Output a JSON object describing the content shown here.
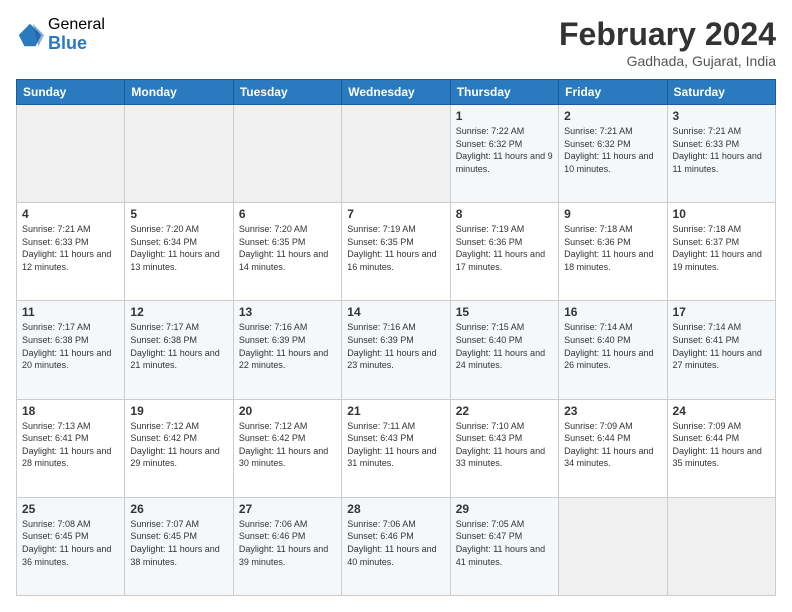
{
  "logo": {
    "general": "General",
    "blue": "Blue"
  },
  "header": {
    "title": "February 2024",
    "subtitle": "Gadhada, Gujarat, India"
  },
  "days_of_week": [
    "Sunday",
    "Monday",
    "Tuesday",
    "Wednesday",
    "Thursday",
    "Friday",
    "Saturday"
  ],
  "weeks": [
    [
      {
        "day": "",
        "info": ""
      },
      {
        "day": "",
        "info": ""
      },
      {
        "day": "",
        "info": ""
      },
      {
        "day": "",
        "info": ""
      },
      {
        "day": "1",
        "info": "Sunrise: 7:22 AM\nSunset: 6:32 PM\nDaylight: 11 hours and 9 minutes."
      },
      {
        "day": "2",
        "info": "Sunrise: 7:21 AM\nSunset: 6:32 PM\nDaylight: 11 hours and 10 minutes."
      },
      {
        "day": "3",
        "info": "Sunrise: 7:21 AM\nSunset: 6:33 PM\nDaylight: 11 hours and 11 minutes."
      }
    ],
    [
      {
        "day": "4",
        "info": "Sunrise: 7:21 AM\nSunset: 6:33 PM\nDaylight: 11 hours and 12 minutes."
      },
      {
        "day": "5",
        "info": "Sunrise: 7:20 AM\nSunset: 6:34 PM\nDaylight: 11 hours and 13 minutes."
      },
      {
        "day": "6",
        "info": "Sunrise: 7:20 AM\nSunset: 6:35 PM\nDaylight: 11 hours and 14 minutes."
      },
      {
        "day": "7",
        "info": "Sunrise: 7:19 AM\nSunset: 6:35 PM\nDaylight: 11 hours and 16 minutes."
      },
      {
        "day": "8",
        "info": "Sunrise: 7:19 AM\nSunset: 6:36 PM\nDaylight: 11 hours and 17 minutes."
      },
      {
        "day": "9",
        "info": "Sunrise: 7:18 AM\nSunset: 6:36 PM\nDaylight: 11 hours and 18 minutes."
      },
      {
        "day": "10",
        "info": "Sunrise: 7:18 AM\nSunset: 6:37 PM\nDaylight: 11 hours and 19 minutes."
      }
    ],
    [
      {
        "day": "11",
        "info": "Sunrise: 7:17 AM\nSunset: 6:38 PM\nDaylight: 11 hours and 20 minutes."
      },
      {
        "day": "12",
        "info": "Sunrise: 7:17 AM\nSunset: 6:38 PM\nDaylight: 11 hours and 21 minutes."
      },
      {
        "day": "13",
        "info": "Sunrise: 7:16 AM\nSunset: 6:39 PM\nDaylight: 11 hours and 22 minutes."
      },
      {
        "day": "14",
        "info": "Sunrise: 7:16 AM\nSunset: 6:39 PM\nDaylight: 11 hours and 23 minutes."
      },
      {
        "day": "15",
        "info": "Sunrise: 7:15 AM\nSunset: 6:40 PM\nDaylight: 11 hours and 24 minutes."
      },
      {
        "day": "16",
        "info": "Sunrise: 7:14 AM\nSunset: 6:40 PM\nDaylight: 11 hours and 26 minutes."
      },
      {
        "day": "17",
        "info": "Sunrise: 7:14 AM\nSunset: 6:41 PM\nDaylight: 11 hours and 27 minutes."
      }
    ],
    [
      {
        "day": "18",
        "info": "Sunrise: 7:13 AM\nSunset: 6:41 PM\nDaylight: 11 hours and 28 minutes."
      },
      {
        "day": "19",
        "info": "Sunrise: 7:12 AM\nSunset: 6:42 PM\nDaylight: 11 hours and 29 minutes."
      },
      {
        "day": "20",
        "info": "Sunrise: 7:12 AM\nSunset: 6:42 PM\nDaylight: 11 hours and 30 minutes."
      },
      {
        "day": "21",
        "info": "Sunrise: 7:11 AM\nSunset: 6:43 PM\nDaylight: 11 hours and 31 minutes."
      },
      {
        "day": "22",
        "info": "Sunrise: 7:10 AM\nSunset: 6:43 PM\nDaylight: 11 hours and 33 minutes."
      },
      {
        "day": "23",
        "info": "Sunrise: 7:09 AM\nSunset: 6:44 PM\nDaylight: 11 hours and 34 minutes."
      },
      {
        "day": "24",
        "info": "Sunrise: 7:09 AM\nSunset: 6:44 PM\nDaylight: 11 hours and 35 minutes."
      }
    ],
    [
      {
        "day": "25",
        "info": "Sunrise: 7:08 AM\nSunset: 6:45 PM\nDaylight: 11 hours and 36 minutes."
      },
      {
        "day": "26",
        "info": "Sunrise: 7:07 AM\nSunset: 6:45 PM\nDaylight: 11 hours and 38 minutes."
      },
      {
        "day": "27",
        "info": "Sunrise: 7:06 AM\nSunset: 6:46 PM\nDaylight: 11 hours and 39 minutes."
      },
      {
        "day": "28",
        "info": "Sunrise: 7:06 AM\nSunset: 6:46 PM\nDaylight: 11 hours and 40 minutes."
      },
      {
        "day": "29",
        "info": "Sunrise: 7:05 AM\nSunset: 6:47 PM\nDaylight: 11 hours and 41 minutes."
      },
      {
        "day": "",
        "info": ""
      },
      {
        "day": "",
        "info": ""
      }
    ]
  ]
}
